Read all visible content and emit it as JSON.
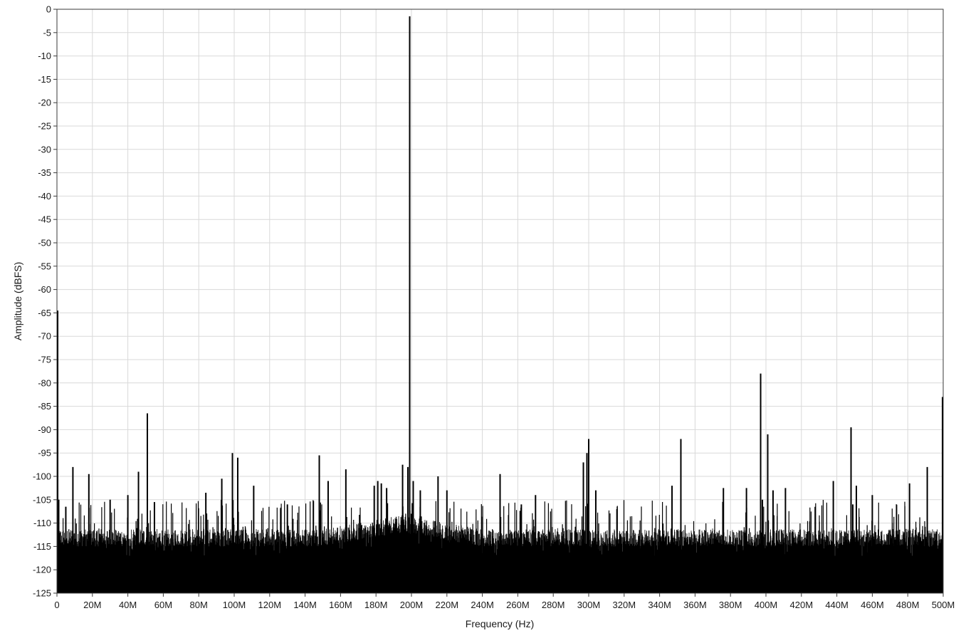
{
  "chart_data": {
    "type": "line",
    "title": "",
    "xlabel": "Frequency (Hz)",
    "ylabel": "Amplitude (dBFS)",
    "xlim": [
      0,
      500000000
    ],
    "ylim": [
      -125,
      0
    ],
    "grid": true,
    "x_ticks": [
      0,
      20000000,
      40000000,
      60000000,
      80000000,
      100000000,
      120000000,
      140000000,
      160000000,
      180000000,
      200000000,
      220000000,
      240000000,
      260000000,
      280000000,
      300000000,
      320000000,
      340000000,
      360000000,
      380000000,
      400000000,
      420000000,
      440000000,
      460000000,
      480000000,
      500000000
    ],
    "x_tick_labels": [
      "0",
      "20M",
      "40M",
      "60M",
      "80M",
      "100M",
      "120M",
      "140M",
      "160M",
      "180M",
      "200M",
      "220M",
      "240M",
      "260M",
      "280M",
      "300M",
      "320M",
      "340M",
      "360M",
      "380M",
      "400M",
      "420M",
      "440M",
      "460M",
      "480M",
      "500M"
    ],
    "y_ticks": [
      0,
      -5,
      -10,
      -15,
      -20,
      -25,
      -30,
      -35,
      -40,
      -45,
      -50,
      -55,
      -60,
      -65,
      -70,
      -75,
      -80,
      -85,
      -90,
      -95,
      -100,
      -105,
      -110,
      -115,
      -120,
      -125
    ],
    "y_tick_labels": [
      "0",
      "-5",
      "-10",
      "-15",
      "-20",
      "-25",
      "-30",
      "-35",
      "-40",
      "-45",
      "-50",
      "-55",
      "-60",
      "-65",
      "-70",
      "-75",
      "-80",
      "-85",
      "-90",
      "-95",
      "-100",
      "-105",
      "-110",
      "-115",
      "-120",
      "-125"
    ],
    "noise_floor_dbfs": [
      -116,
      -125
    ],
    "series": [
      {
        "color": "#000000",
        "x": [
          0,
          1000000,
          5000000,
          9000000,
          18000000,
          30000000,
          40000000,
          46000000,
          51000000,
          55000000,
          84000000,
          93000000,
          99000000,
          102000000,
          111000000,
          130000000,
          148000000,
          153000000,
          163000000,
          179000000,
          181000000,
          183000000,
          186000000,
          195000000,
          198000000,
          199000000,
          200000000,
          201000000,
          205000000,
          215000000,
          220000000,
          250000000,
          262000000,
          270000000,
          297000000,
          299000000,
          300000000,
          304000000,
          347000000,
          352000000,
          376000000,
          389000000,
          397000000,
          398000000,
          401000000,
          404000000,
          411000000,
          438000000,
          448000000,
          449000000,
          451000000,
          460000000,
          481000000,
          491000000,
          500000000
        ],
        "y": [
          -64.5,
          -105,
          -106.5,
          -98,
          -99.5,
          -105,
          -104,
          -99,
          -86.5,
          -105.5,
          -103.5,
          -100.5,
          -95,
          -96,
          -102,
          -106,
          -95.5,
          -101,
          -98.5,
          -102,
          -101,
          -101.5,
          -102.5,
          -97.5,
          -98,
          -1.5,
          -108,
          -101,
          -103,
          -100,
          -103,
          -99.5,
          -106,
          -104,
          -97,
          -95,
          -92,
          -103,
          -102,
          -92,
          -102.5,
          -102.5,
          -78,
          -105,
          -91,
          -103,
          -102.5,
          -101,
          -89.5,
          -106,
          -102,
          -104,
          -101.5,
          -98,
          -83
        ]
      }
    ]
  }
}
